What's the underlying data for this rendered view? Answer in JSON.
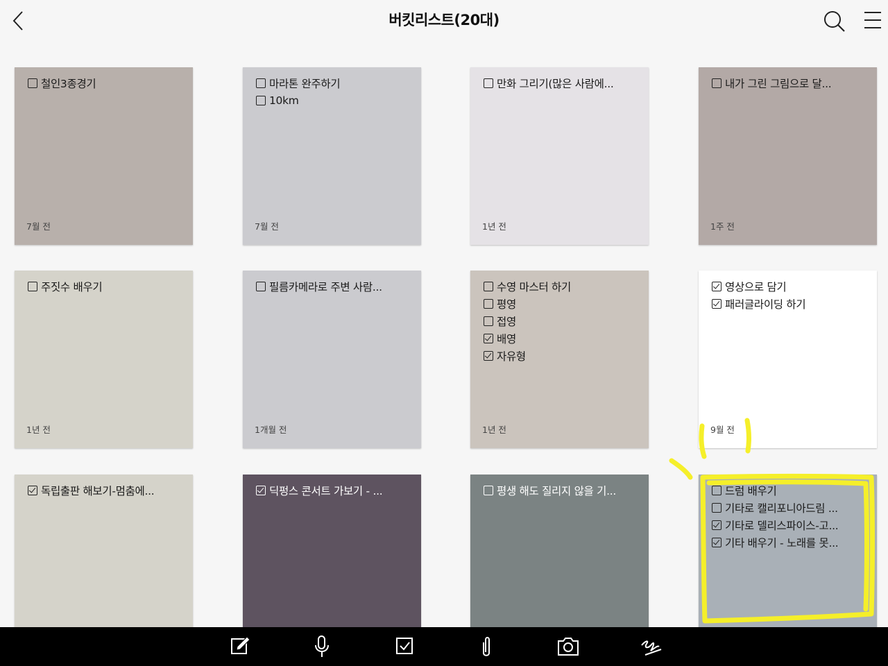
{
  "header": {
    "title": "버킷리스트(20대)"
  },
  "notes": [
    {
      "items": [
        {
          "text": "철인3종경기",
          "checked": false
        }
      ],
      "time": "7월 전",
      "color": "#b8b0ab"
    },
    {
      "items": [
        {
          "text": "마라톤 완주하기",
          "checked": false
        },
        {
          "text": "10km",
          "checked": false
        }
      ],
      "time": "7월 전",
      "color": "#cbcbcf"
    },
    {
      "items": [
        {
          "text": "만화 그리기(많은 사람에...",
          "checked": false
        }
      ],
      "time": "1년 전",
      "color": "#e5e2e6"
    },
    {
      "items": [
        {
          "text": "내가 그린 그림으로 달...",
          "checked": false
        }
      ],
      "time": "1주 전",
      "color": "#b3a9a6"
    },
    {
      "items": [
        {
          "text": "주짓수 배우기",
          "checked": false
        }
      ],
      "time": "1년 전",
      "color": "#d5d3ca"
    },
    {
      "items": [
        {
          "text": "필름카메라로 주변 사람...",
          "checked": false
        }
      ],
      "time": "1개월 전",
      "color": "#cbcbcf"
    },
    {
      "items": [
        {
          "text": "수영 마스터 하기",
          "checked": false
        },
        {
          "text": "평영",
          "checked": false
        },
        {
          "text": "접영",
          "checked": false
        },
        {
          "text": "배영",
          "checked": true
        },
        {
          "text": "자유형",
          "checked": true
        }
      ],
      "time": "1년 전",
      "color": "#cbc4bd"
    },
    {
      "items": [
        {
          "text": "영상으로 담기",
          "checked": true
        },
        {
          "text": "패러글라이딩 하기",
          "checked": true
        }
      ],
      "time": "9월 전",
      "color": "#ffffff"
    },
    {
      "items": [
        {
          "text": "독립출판 해보기-멈춤에...",
          "checked": true
        }
      ],
      "time": "",
      "color": "#d5d3ca"
    },
    {
      "items": [
        {
          "text": "딕펑스 콘서트 가보기 - ...",
          "checked": true
        }
      ],
      "time": "",
      "color": "#5e5360",
      "dark": true
    },
    {
      "items": [
        {
          "text": "평생 해도 질리지 않을 기...",
          "checked": false
        }
      ],
      "time": "",
      "color": "#7b8383",
      "dark": true
    },
    {
      "items": [
        {
          "text": "드럼 배우기",
          "checked": false
        },
        {
          "text": "기타로 캘리포니아드림 ...",
          "checked": false
        },
        {
          "text": "기타로 델리스파이스-고...",
          "checked": true
        },
        {
          "text": "기타 배우기 - 노래를 못...",
          "checked": true
        }
      ],
      "time": "",
      "color": "#a9b0b7"
    }
  ],
  "toolbar": [
    {
      "name": "compose-icon"
    },
    {
      "name": "microphone-icon"
    },
    {
      "name": "checkbox-icon"
    },
    {
      "name": "paperclip-icon"
    },
    {
      "name": "camera-icon"
    },
    {
      "name": "handwriting-icon"
    }
  ],
  "annotation": {
    "color": "#f5ef2a"
  }
}
